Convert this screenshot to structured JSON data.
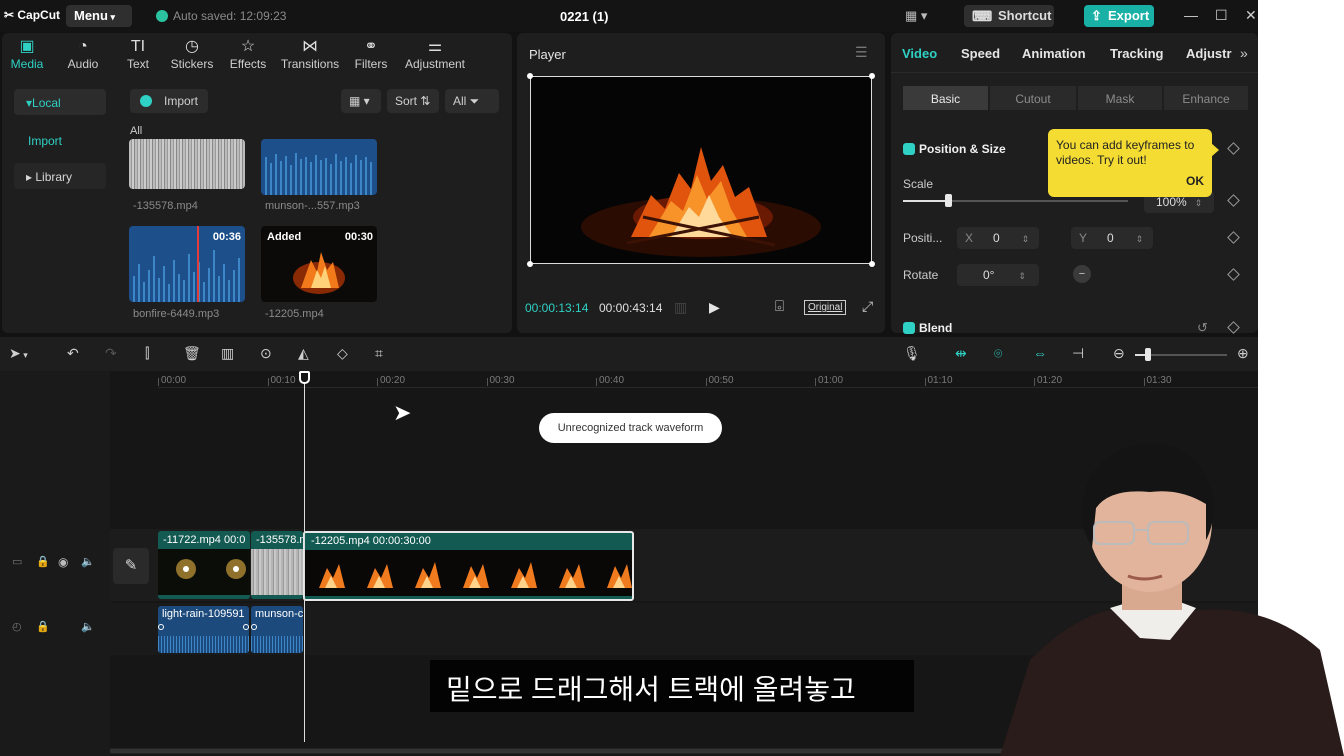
{
  "titlebar": {
    "logo": "CapCut",
    "menu_label": "Menu",
    "autosave": "Auto saved: 12:09:23",
    "project_title": "0221 (1)",
    "shortcut_label": "Shortcut",
    "export_label": "Export"
  },
  "media_toolbar": [
    {
      "label": "Media",
      "icon": "media-icon"
    },
    {
      "label": "Audio",
      "icon": "audio-icon"
    },
    {
      "label": "Text",
      "icon": "text-icon"
    },
    {
      "label": "Stickers",
      "icon": "sticker-icon"
    },
    {
      "label": "Effects",
      "icon": "effects-icon"
    },
    {
      "label": "Transitions",
      "icon": "transition-icon"
    },
    {
      "label": "Filters",
      "icon": "filters-icon"
    },
    {
      "label": "Adjustment",
      "icon": "adjust-icon"
    }
  ],
  "media_side": {
    "local": "Local",
    "import": "Import",
    "library": "Library"
  },
  "media_header": {
    "import": "Import",
    "sort": "Sort",
    "all": "All",
    "group_all": "All"
  },
  "media_items": [
    {
      "name": "-135578.mp4"
    },
    {
      "name": "munson-...557.mp3"
    },
    {
      "name": "bonfire-6449.mp3",
      "duration": "00:36"
    },
    {
      "name": "-12205.mp4",
      "badge": "Added",
      "duration": "00:30"
    }
  ],
  "player": {
    "title": "Player",
    "current_time": "00:00:13:14",
    "total_time": "00:00:43:14",
    "original_label": "Original"
  },
  "props": {
    "tabs": [
      "Video",
      "Speed",
      "Animation",
      "Tracking",
      "Adjustr"
    ],
    "subtabs": [
      "Basic",
      "Cutout",
      "Mask",
      "Enhance"
    ],
    "position_size": "Position & Size",
    "scale_label": "Scale",
    "scale_value": "100%",
    "scale_fraction": 0.2,
    "position_label": "Positi...",
    "x_label": "X",
    "x_value": "0",
    "y_label": "Y",
    "y_value": "0",
    "rotate_label": "Rotate",
    "rotate_value": "0°",
    "blend_label": "Blend",
    "tooltip_text": "You can add keyframes to videos. Try it out!",
    "tooltip_ok": "OK"
  },
  "ruler": [
    "00:00",
    "00:10",
    "00:20",
    "00:30",
    "00:40",
    "00:50",
    "01:00",
    "01:10",
    "01:20",
    "01:30"
  ],
  "timeline": {
    "hint": "Unrecognized track waveform",
    "video_clips": [
      {
        "label": "-11722.mp4  00:0"
      },
      {
        "label": "-135578.m"
      },
      {
        "label": "-12205.mp4  00:00:30:00"
      }
    ],
    "audio_clips": [
      {
        "label": "light-rain-109591"
      },
      {
        "label": "munson-c"
      }
    ]
  },
  "caption": "밑으로 드래그해서 트랙에 올려놓고",
  "colors": {
    "accent": "#2fd1c4",
    "export": "#19b0a6",
    "tooltip": "#f4dc33",
    "clip_green": "#135a52"
  }
}
